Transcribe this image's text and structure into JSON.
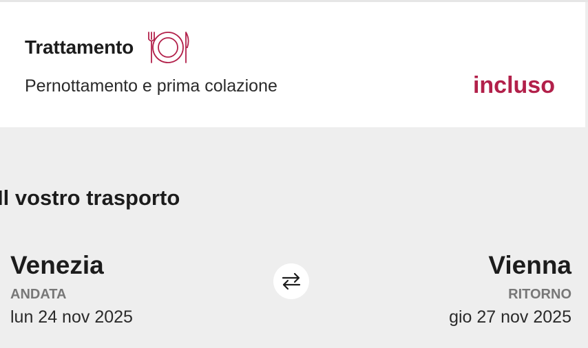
{
  "board": {
    "title": "Trattamento",
    "icon": "plate-with-cutlery-icon",
    "description": "Pernottamento e prima colazione",
    "status": "incluso",
    "accent_color": "#b2204a"
  },
  "transport": {
    "heading": "Il vostro trasporto",
    "outbound": {
      "city": "Venezia",
      "type": "ANDATA",
      "date": "lun 24 nov 2025"
    },
    "return": {
      "city": "Vienna",
      "type": "RITORNO",
      "date": "gio 27 nov 2025"
    },
    "swap_icon": "swap-arrows-icon"
  }
}
